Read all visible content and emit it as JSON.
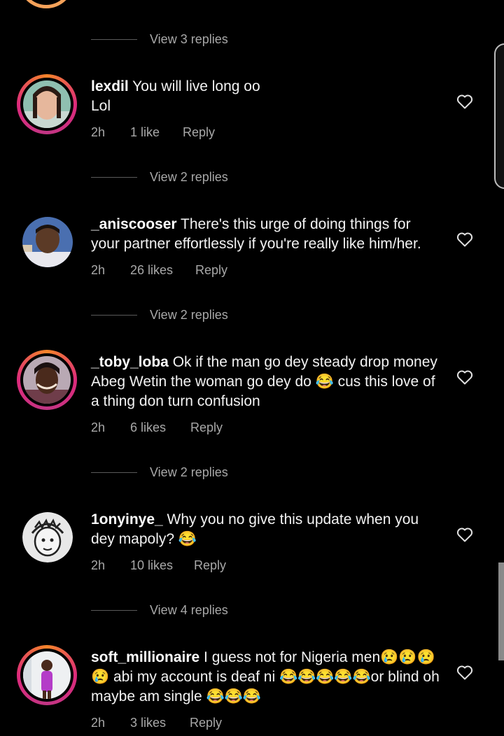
{
  "top": {
    "view_replies": "View 3 replies"
  },
  "comments": [
    {
      "username": "lexdil",
      "text": " You will live long oo\nLol",
      "time": "2h",
      "likes": "1 like",
      "reply": "Reply",
      "view_replies": "View 2 replies"
    },
    {
      "username": "_aniscooser",
      "text": " There's this urge of doing things for your partner effortlessly if you're really like him/her.",
      "time": "2h",
      "likes": "26 likes",
      "reply": "Reply",
      "view_replies": "View 2 replies"
    },
    {
      "username": "_toby_loba",
      "text": " Ok if the man go dey steady drop money Abeg Wetin the woman go dey do 😂 cus this love of a thing don turn confusion",
      "time": "2h",
      "likes": "6 likes",
      "reply": "Reply",
      "view_replies": "View 2 replies"
    },
    {
      "username": "1onyinye_",
      "text": " Why you no give this update when you dey mapoly? 😂",
      "time": "2h",
      "likes": "10 likes",
      "reply": "Reply",
      "view_replies": "View 4 replies"
    },
    {
      "username": "soft_millionaire",
      "text": " I guess not for Nigeria men😢😢😢😢 abi my account is deaf ni 😂😂😂😂😂or blind oh maybe am single 😂😂😂",
      "time": "2h",
      "likes": "3 likes",
      "reply": "Reply"
    }
  ],
  "colors": {
    "background": "#000000",
    "text": "#ffffff",
    "muted": "#a8a8a8",
    "story_ring": "#dd2a7b"
  },
  "icons": {
    "like": "heart-outline-icon"
  }
}
